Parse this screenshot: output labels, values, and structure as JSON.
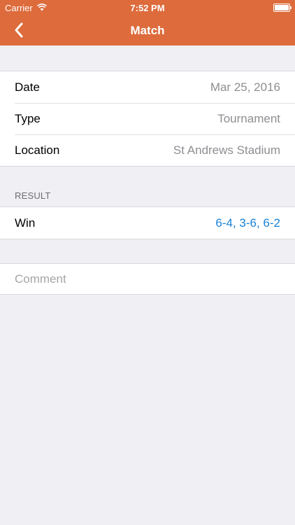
{
  "status_bar": {
    "carrier": "Carrier",
    "time": "7:52 PM",
    "wifi_icon": "wifi-icon",
    "battery_icon": "battery-icon"
  },
  "nav": {
    "title": "Match",
    "back_icon": "chevron-left-icon",
    "tint": "#dd6b3c"
  },
  "details": [
    {
      "label": "Date",
      "value": "Mar 25, 2016"
    },
    {
      "label": "Type",
      "value": "Tournament"
    },
    {
      "label": "Location",
      "value": "St Andrews Stadium"
    }
  ],
  "result": {
    "header": "RESULT",
    "label": "Win",
    "score": "6-4, 3-6, 6-2",
    "score_color": "#1a82d8"
  },
  "comment": {
    "placeholder": "Comment",
    "value": ""
  }
}
